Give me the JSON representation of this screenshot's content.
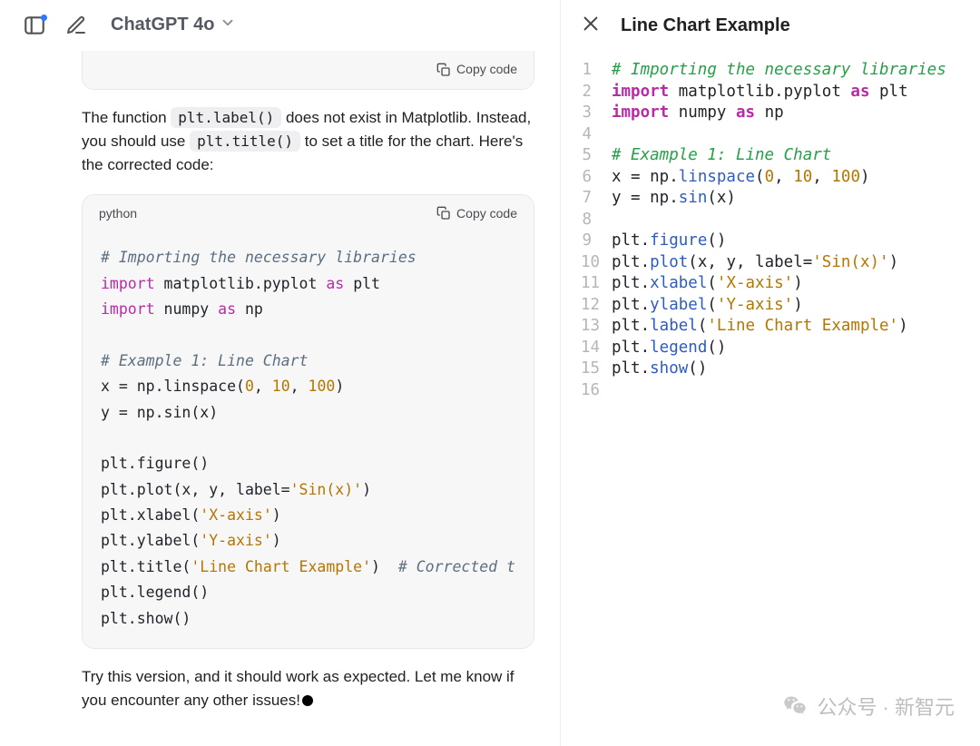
{
  "header": {
    "model_name": "ChatGPT 4o",
    "sidebar_icon": "sidebar-toggle-icon",
    "new_chat_icon": "new-chat-icon"
  },
  "chat": {
    "code_card_top": {
      "copy_label": "Copy code"
    },
    "paragraph_intro_1": "The function ",
    "paragraph_intro_code1": "plt.label()",
    "paragraph_intro_2": " does not exist in Matplotlib. Instead, you should use ",
    "paragraph_intro_code2": "plt.title()",
    "paragraph_intro_3": " to set a title for the chart. Here's the corrected code:",
    "code_card_main": {
      "language": "python",
      "copy_label": "Copy code",
      "lines": [
        {
          "type": "comment",
          "text": "# Importing the necessary libraries"
        },
        {
          "type": "import",
          "k1": "import",
          "m": "matplotlib.pyplot",
          "k2": "as",
          "a": "plt"
        },
        {
          "type": "import",
          "k1": "import",
          "m": "numpy",
          "k2": "as",
          "a": "np"
        },
        {
          "type": "blank"
        },
        {
          "type": "comment",
          "text": "# Example 1: Line Chart"
        },
        {
          "type": "linspace"
        },
        {
          "type": "sin"
        },
        {
          "type": "blank"
        },
        {
          "type": "call",
          "text": "plt.figure()"
        },
        {
          "type": "plot"
        },
        {
          "type": "xlabel"
        },
        {
          "type": "ylabel"
        },
        {
          "type": "title"
        },
        {
          "type": "call",
          "text": "plt.legend()"
        },
        {
          "type": "call",
          "text": "plt.show()"
        }
      ]
    },
    "paragraph_outro": "Try this version, and it should work as expected. Let me know if you encounter any other issues!"
  },
  "panel": {
    "title": "Line Chart Example",
    "lines": [
      {
        "n": 1,
        "tokens": [
          [
            "e-cm",
            "# Importing the necessary libraries"
          ]
        ]
      },
      {
        "n": 2,
        "tokens": [
          [
            "e-kw",
            "import "
          ],
          [
            "e-id",
            "matplotlib.pyplot "
          ],
          [
            "e-kw",
            "as "
          ],
          [
            "e-id",
            "plt"
          ]
        ]
      },
      {
        "n": 3,
        "tokens": [
          [
            "e-kw",
            "import "
          ],
          [
            "e-id",
            "numpy "
          ],
          [
            "e-kw",
            "as "
          ],
          [
            "e-id",
            "np"
          ]
        ]
      },
      {
        "n": 4,
        "tokens": [
          [
            "e-id",
            ""
          ]
        ]
      },
      {
        "n": 5,
        "tokens": [
          [
            "e-cm",
            "# Example 1: Line Chart"
          ]
        ]
      },
      {
        "n": 6,
        "tokens": [
          [
            "e-id",
            "x = np."
          ],
          [
            "e-fn",
            "linspace"
          ],
          [
            "e-id",
            "("
          ],
          [
            "e-num",
            "0"
          ],
          [
            "e-id",
            ", "
          ],
          [
            "e-num",
            "10"
          ],
          [
            "e-id",
            ", "
          ],
          [
            "e-num",
            "100"
          ],
          [
            "e-id",
            ")"
          ]
        ]
      },
      {
        "n": 7,
        "tokens": [
          [
            "e-id",
            "y = np."
          ],
          [
            "e-fn",
            "sin"
          ],
          [
            "e-id",
            "(x)"
          ]
        ]
      },
      {
        "n": 8,
        "tokens": [
          [
            "e-id",
            ""
          ]
        ]
      },
      {
        "n": 9,
        "tokens": [
          [
            "e-id",
            "plt."
          ],
          [
            "e-fn",
            "figure"
          ],
          [
            "e-id",
            "()"
          ]
        ]
      },
      {
        "n": 10,
        "tokens": [
          [
            "e-id",
            "plt."
          ],
          [
            "e-fn",
            "plot"
          ],
          [
            "e-id",
            "(x, y, label="
          ],
          [
            "e-str",
            "'Sin(x)'"
          ],
          [
            "e-id",
            ")"
          ]
        ]
      },
      {
        "n": 11,
        "tokens": [
          [
            "e-id",
            "plt."
          ],
          [
            "e-fn",
            "xlabel"
          ],
          [
            "e-id",
            "("
          ],
          [
            "e-str",
            "'X-axis'"
          ],
          [
            "e-id",
            ")"
          ]
        ]
      },
      {
        "n": 12,
        "tokens": [
          [
            "e-id",
            "plt."
          ],
          [
            "e-fn",
            "ylabel"
          ],
          [
            "e-id",
            "("
          ],
          [
            "e-str",
            "'Y-axis'"
          ],
          [
            "e-id",
            ")"
          ]
        ]
      },
      {
        "n": 13,
        "tokens": [
          [
            "e-id",
            "plt."
          ],
          [
            "e-fn",
            "label"
          ],
          [
            "e-id",
            "("
          ],
          [
            "e-str",
            "'Line Chart Example'"
          ],
          [
            "e-id",
            ")"
          ]
        ]
      },
      {
        "n": 14,
        "tokens": [
          [
            "e-id",
            "plt."
          ],
          [
            "e-fn",
            "legend"
          ],
          [
            "e-id",
            "()"
          ]
        ]
      },
      {
        "n": 15,
        "tokens": [
          [
            "e-id",
            "plt."
          ],
          [
            "e-fn",
            "show"
          ],
          [
            "e-id",
            "()"
          ]
        ]
      },
      {
        "n": 16,
        "tokens": [
          [
            "e-id",
            ""
          ]
        ]
      }
    ]
  },
  "watermark": {
    "text": "公众号 · 新智元"
  }
}
